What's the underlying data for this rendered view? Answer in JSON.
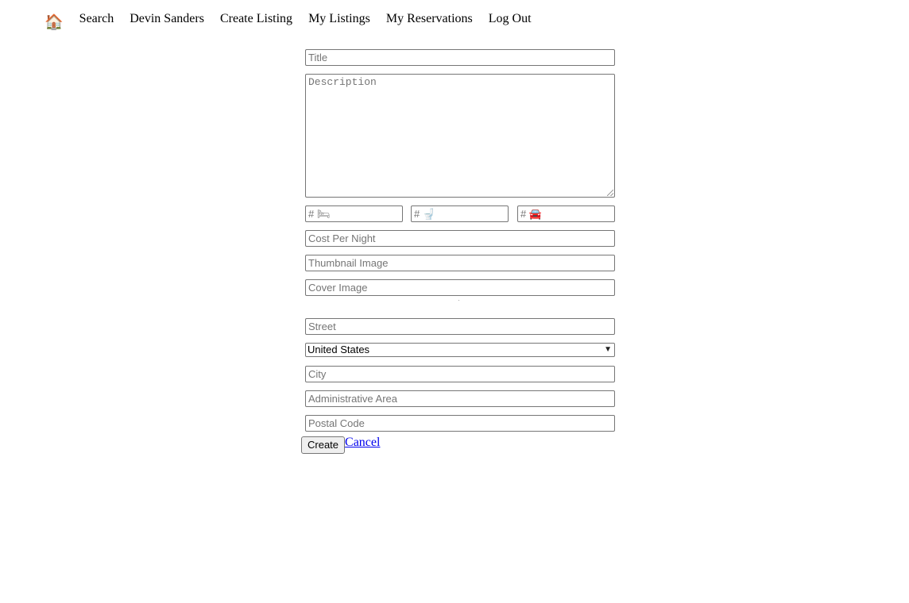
{
  "nav": {
    "home_glyph": "🏠",
    "links": [
      "Search",
      "Devin Sanders",
      "Create Listing",
      "My Listings",
      "My Reservations",
      "Log Out"
    ]
  },
  "form": {
    "title_placeholder": "Title",
    "description_placeholder": "Description",
    "beds_prefix": "#",
    "beds_glyph": "🛏",
    "baths_prefix": "#",
    "baths_glyph": "🚽",
    "parking_prefix": "#",
    "parking_glyph": "🚘",
    "cost_placeholder": "Cost Per Night",
    "thumbnail_placeholder": "Thumbnail Image",
    "cover_placeholder": "Cover Image",
    "street_placeholder": "Street",
    "country_selected": "United States",
    "city_placeholder": "City",
    "admin_area_placeholder": "Administrative Area",
    "postal_placeholder": "Postal Code",
    "create_label": "Create",
    "cancel_label": "Cancel"
  }
}
